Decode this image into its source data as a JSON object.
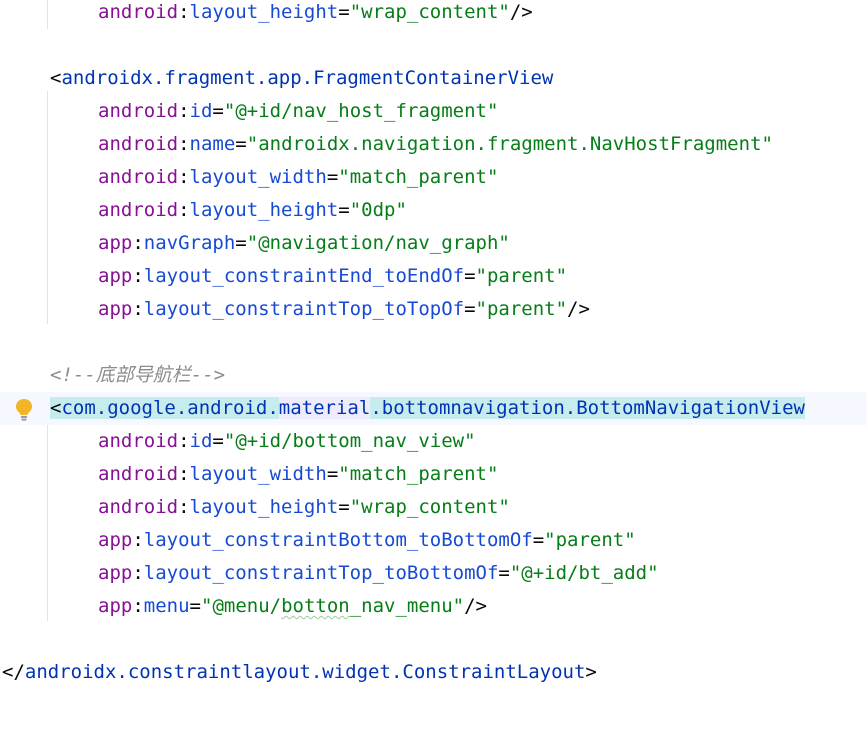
{
  "editor": {
    "lines": [
      {
        "ns": "android",
        "sep": ":",
        "attr": "layout_height",
        "eq": "=",
        "val": "\"wrap_content\"",
        "end": "/>"
      },
      {},
      {
        "open": "<",
        "tag": "androidx.fragment.app.FragmentContainerView"
      },
      {
        "ns": "android",
        "sep": ":",
        "attr": "id",
        "eq": "=",
        "val": "\"@+id/nav_host_fragment\""
      },
      {
        "ns": "android",
        "sep": ":",
        "attr": "name",
        "eq": "=",
        "val": "\"androidx.navigation.fragment.NavHostFragment\""
      },
      {
        "ns": "android",
        "sep": ":",
        "attr": "layout_width",
        "eq": "=",
        "val": "\"match_parent\""
      },
      {
        "ns": "android",
        "sep": ":",
        "attr": "layout_height",
        "eq": "=",
        "val": "\"0dp\""
      },
      {
        "ns": "app",
        "sep": ":",
        "attr": "navGraph",
        "eq": "=",
        "val": "\"@navigation/nav_graph\""
      },
      {
        "ns": "app",
        "sep": ":",
        "attr": "layout_constraintEnd_toEndOf",
        "eq": "=",
        "val": "\"parent\""
      },
      {
        "ns": "app",
        "sep": ":",
        "attr": "layout_constraintTop_toTopOf",
        "eq": "=",
        "val": "\"parent\"",
        "end": "/>"
      },
      {},
      {
        "comment": "<!--底部导航栏-->"
      },
      {
        "open": "<",
        "tag_a": "com.google.android.",
        "tag_b": "material",
        "tag_c": ".bottomnavigation.BottomNavigationView"
      },
      {
        "ns": "android",
        "sep": ":",
        "attr": "id",
        "eq": "=",
        "val": "\"@+id/bottom_nav_view\""
      },
      {
        "ns": "android",
        "sep": ":",
        "attr": "layout_width",
        "eq": "=",
        "val": "\"match_parent\""
      },
      {
        "ns": "android",
        "sep": ":",
        "attr": "layout_height",
        "eq": "=",
        "val": "\"wrap_content\""
      },
      {
        "ns": "app",
        "sep": ":",
        "attr": "layout_constraintBottom_toBottomOf",
        "eq": "=",
        "val": "\"parent\""
      },
      {
        "ns": "app",
        "sep": ":",
        "attr": "layout_constraintTop_toBottomOf",
        "eq": "=",
        "val": "\"@+id/bt_add\""
      },
      {
        "ns": "app",
        "sep": ":",
        "attr": "menu",
        "eq": "=",
        "val_a": "\"@menu/",
        "val_b": "botton",
        "val_c": "_nav_menu\"",
        "end": "/>"
      },
      {},
      {
        "open": "</",
        "tag": "androidx.constraintlayout.widget.ConstraintLayout",
        "close": ">"
      }
    ],
    "colors": {
      "namespace": "#871094",
      "attribute": "#174ad4",
      "value": "#067d17",
      "tag": "#0033b3",
      "comment": "#8c8c8c",
      "tag_highlight": "#c6eced",
      "current_line": "#f5f8fe"
    },
    "gutter_icon": "lightbulb-icon"
  }
}
